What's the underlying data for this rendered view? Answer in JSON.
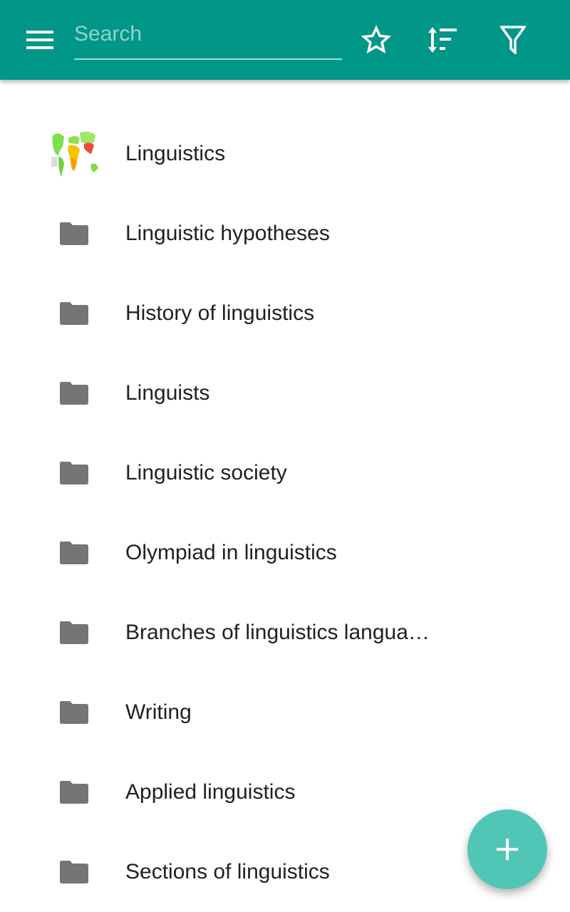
{
  "appbar": {
    "search_placeholder": "Search",
    "search_value": "",
    "icons": [
      "menu-icon",
      "star-icon",
      "sort-icon",
      "filter-icon"
    ]
  },
  "list": {
    "items": [
      {
        "label": "Linguistics",
        "icon": "world-map-thumbnail"
      },
      {
        "label": "Linguistic hypotheses",
        "icon": "folder-icon"
      },
      {
        "label": "History of linguistics",
        "icon": "folder-icon"
      },
      {
        "label": "Linguists",
        "icon": "folder-icon"
      },
      {
        "label": "Linguistic society",
        "icon": "folder-icon"
      },
      {
        "label": "Olympiad in linguistics",
        "icon": "folder-icon"
      },
      {
        "label": "Branches of linguistics langua…",
        "icon": "folder-icon"
      },
      {
        "label": "Writing",
        "icon": "folder-icon"
      },
      {
        "label": "Applied linguistics",
        "icon": "folder-icon"
      },
      {
        "label": "Sections of linguistics",
        "icon": "folder-icon"
      }
    ]
  },
  "fab": {
    "icon": "plus-icon"
  },
  "colors": {
    "primary": "#009688",
    "accent": "#52c6b6",
    "folder": "#757575",
    "text": "#212121"
  }
}
